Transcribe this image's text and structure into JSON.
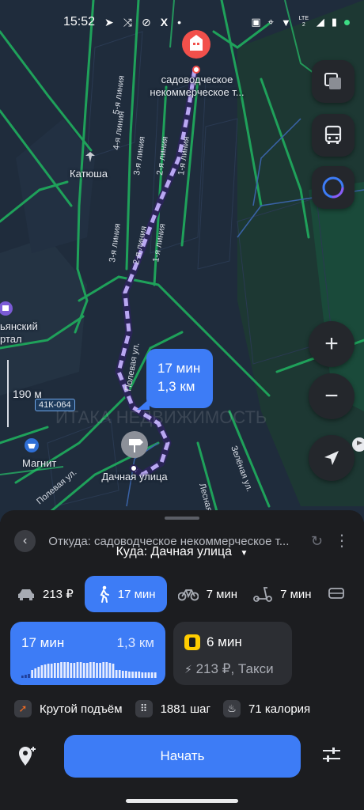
{
  "status_bar": {
    "time": "15:52",
    "left_icons": [
      "telegram-icon",
      "route-icon",
      "link-icon",
      "x-icon",
      "dot-icon"
    ],
    "right_icons": [
      "nfc-icon",
      "location-icon",
      "wifi-icon",
      "signal-lte2-icon",
      "signal-icon",
      "battery-icon"
    ],
    "network_badge": "LTE 2"
  },
  "map": {
    "destination_label": "садоводческое некоммерческое т...",
    "start_label": "Дачная улица",
    "poi_katyusha": "Катюша",
    "poi_magnit": "Магнит",
    "poi_partial": "ьянский ртал",
    "road_badge": "41К-064",
    "scale": "190 м",
    "watermark": "ИТАКА НЕДВИЖИМОСТЬ",
    "street_labels": [
      "5-я линия",
      "4-я линия",
      "3-я линия",
      "2-я линия",
      "1-я линия",
      "3-я линия",
      "2-я линия",
      "1-я линия",
      "Полевая ул.",
      "Полевая ул.",
      "Лесная",
      "Зелёная ул."
    ]
  },
  "route_bubble": {
    "time": "17 мин",
    "distance": "1,3 км"
  },
  "sheet": {
    "from": "Откуда: садоводческое некоммерческое т...",
    "to": "Куда: Дачная улица",
    "to_arrow": "▼",
    "modes": [
      {
        "icon": "car-icon",
        "label": "213 ₽"
      },
      {
        "icon": "walk-icon",
        "label": "17 мин",
        "active": true
      },
      {
        "icon": "bike-icon",
        "label": "7 мин"
      },
      {
        "icon": "scooter-icon",
        "label": "7 мин"
      }
    ],
    "walk_card": {
      "time": "17 мин",
      "distance": "1,3 км"
    },
    "taxi_card": {
      "time": "6 мин",
      "price": "213 ₽, Такси"
    },
    "stats": [
      {
        "icon": "steep-climb-icon",
        "label": "Крутой подъём",
        "color": "#f26b22"
      },
      {
        "icon": "footsteps-icon",
        "label": "1881 шаг",
        "color": "#3a3c42"
      },
      {
        "icon": "flame-icon",
        "label": "71 калория",
        "color": "#3a3c42"
      }
    ],
    "start_button": "Начать"
  },
  "colors": {
    "accent": "#3d7cf6",
    "sheet_bg": "#1c1d20",
    "card_bg": "#2c2e33",
    "road_green": "#1fa15a",
    "route_dash": "#b9a7f2",
    "dest_pin": "#f2504b"
  }
}
